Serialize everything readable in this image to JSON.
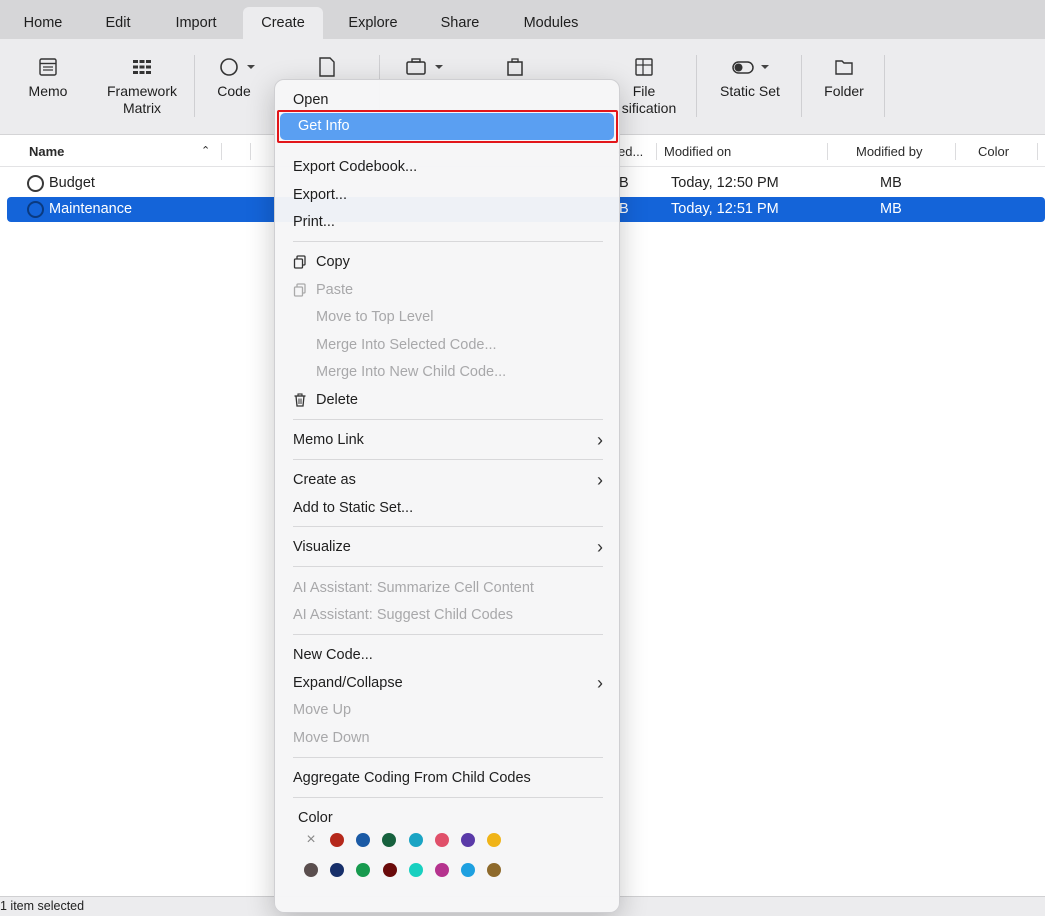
{
  "tabs": [
    "Home",
    "Edit",
    "Import",
    "Create",
    "Explore",
    "Share",
    "Modules"
  ],
  "active_tab": "Create",
  "ribbon": {
    "memo": "Memo",
    "framework_line1": "Framework",
    "framework_line2": "Matrix",
    "code": "Code",
    "file_line1": "File",
    "file_line2": "sification",
    "static_set": "Static Set",
    "folder": "Folder"
  },
  "columns": {
    "name": "Name",
    "created_by_trunc": "ed...",
    "modified_on": "Modified on",
    "modified_by": "Modified by",
    "color": "Color"
  },
  "rows": [
    {
      "name": "Budget",
      "created_by": "B",
      "modified_on": "Today, 12:50 PM",
      "modified_by": "MB"
    },
    {
      "name": "Maintenance",
      "created_by": "B",
      "modified_on": "Today, 12:51 PM",
      "modified_by": "MB"
    }
  ],
  "status": "1 item selected",
  "menu": {
    "open": "Open",
    "get_info": "Get Info",
    "export_codebook": "Export Codebook...",
    "export": "Export...",
    "print": "Print...",
    "copy": "Copy",
    "paste": "Paste",
    "move_top": "Move to Top Level",
    "merge_selected": "Merge Into Selected Code...",
    "merge_new": "Merge Into New Child Code...",
    "delete": "Delete",
    "memo_link": "Memo Link",
    "create_as": "Create as",
    "add_static": "Add to Static Set...",
    "visualize": "Visualize",
    "ai_summarize": "AI Assistant: Summarize Cell Content",
    "ai_suggest": "AI Assistant: Suggest Child Codes",
    "new_code": "New Code...",
    "expand_collapse": "Expand/Collapse",
    "move_up": "Move Up",
    "move_down": "Move Down",
    "aggregate": "Aggregate Coding From Child Codes",
    "color_label": "Color",
    "no_color_symbol": "×",
    "colors_row1": [
      "#b5281b",
      "#1b5aa5",
      "#17613e",
      "#1aa4c4",
      "#e0506a",
      "#5a3aa8",
      "#f0b418"
    ],
    "colors_row2": [
      "#5a4e4e",
      "#172f6a",
      "#179a4e",
      "#6a0a0a",
      "#18d0c0",
      "#b5338e",
      "#1ea0e0",
      "#8e6a2c"
    ]
  }
}
